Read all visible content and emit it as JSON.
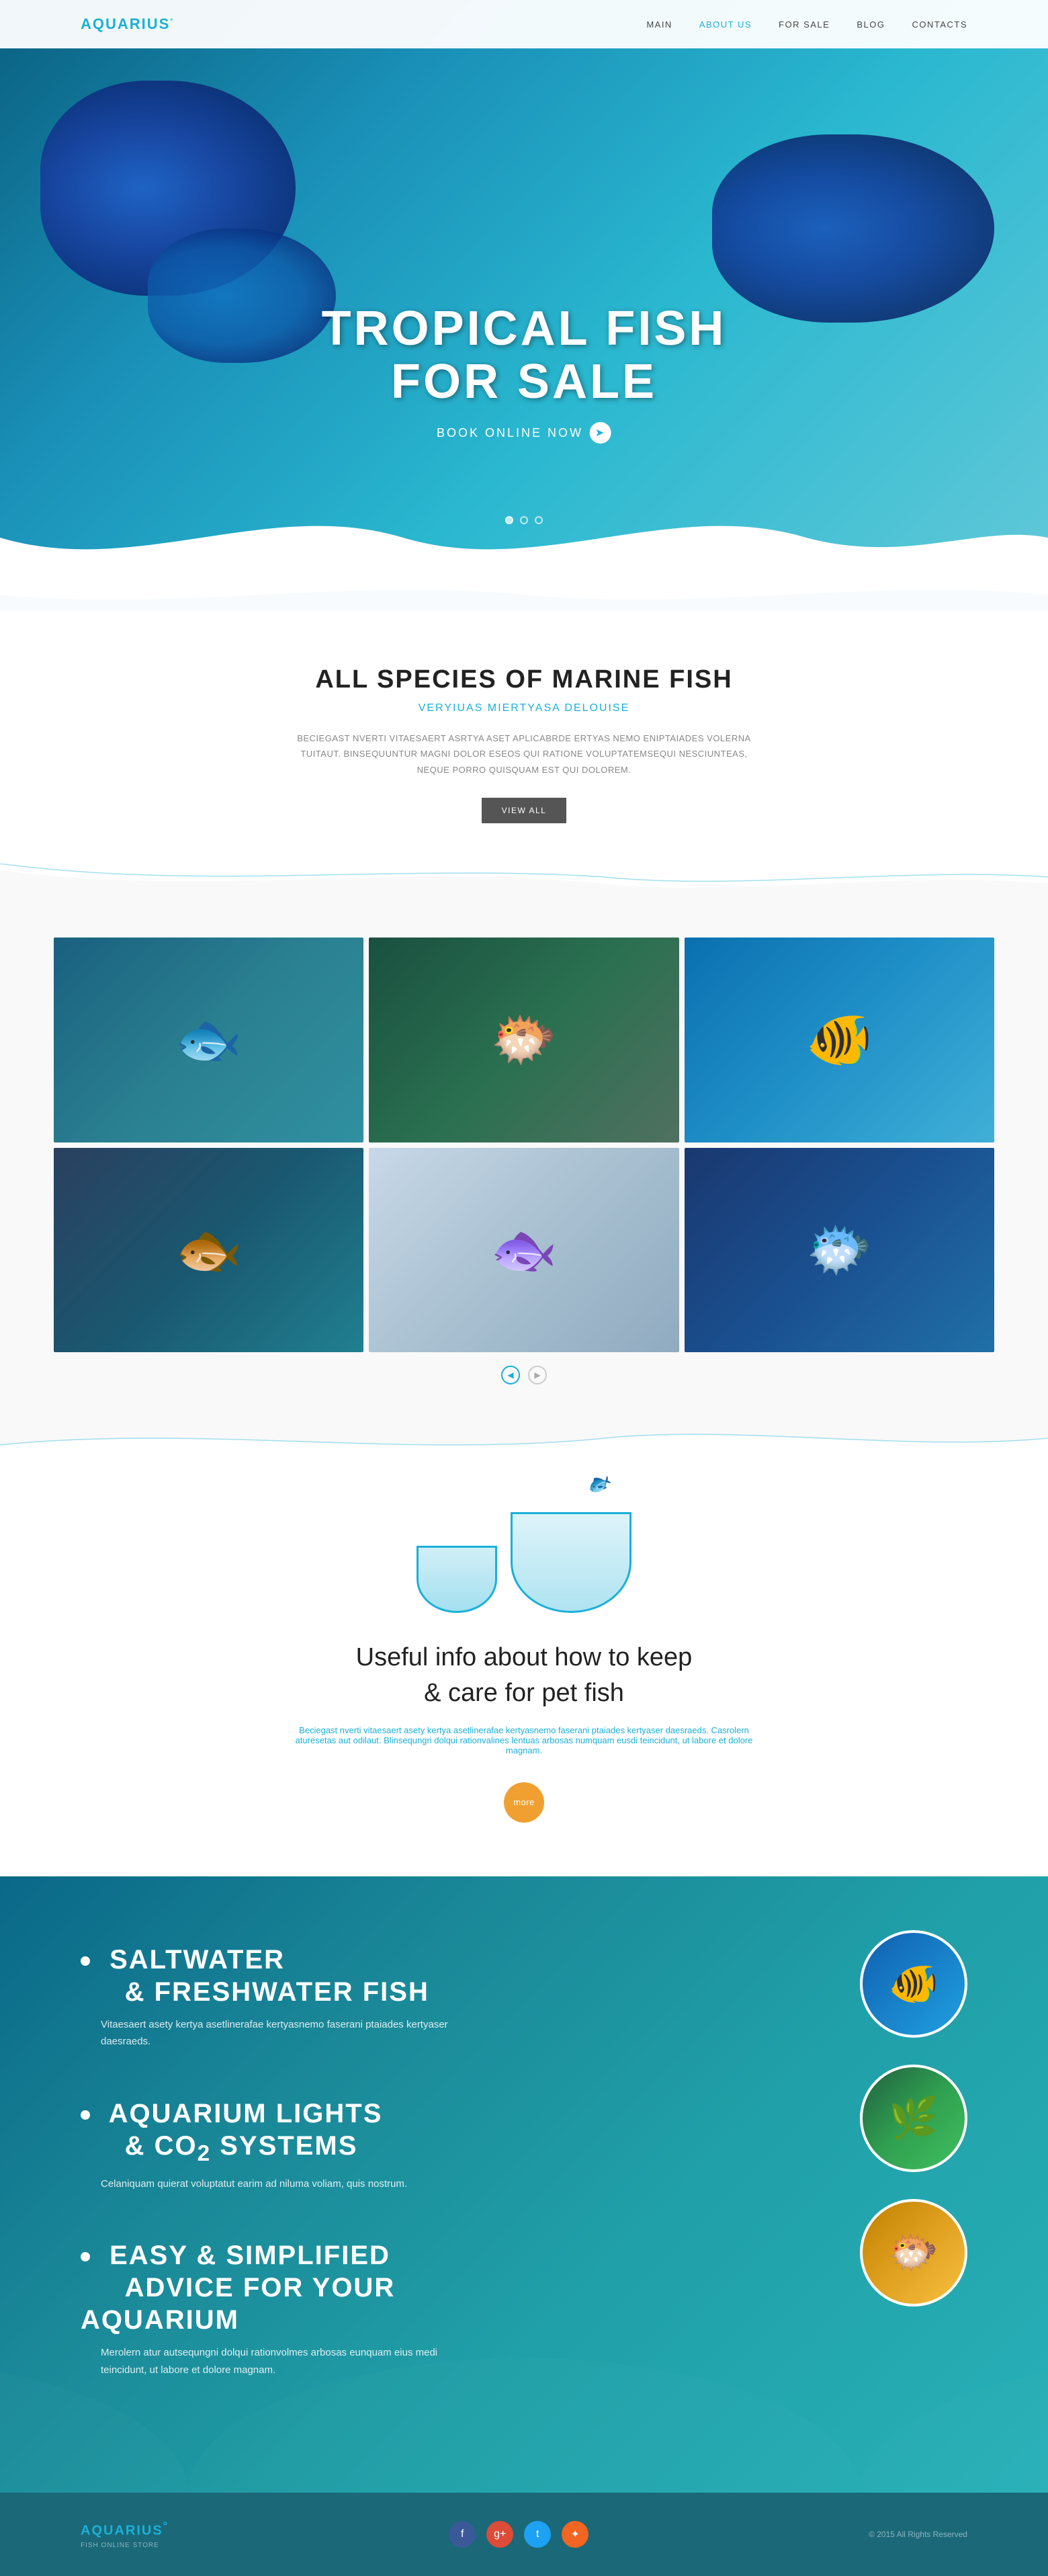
{
  "nav": {
    "logo": "AQUARIUS",
    "logo_sup": "°",
    "links": [
      {
        "label": "MAIN",
        "href": "#",
        "active": false
      },
      {
        "label": "ABOUT US",
        "href": "#",
        "active": true
      },
      {
        "label": "FOR SALE",
        "href": "#",
        "active": false
      },
      {
        "label": "BLOG",
        "href": "#",
        "active": false
      },
      {
        "label": "CONTACTS",
        "href": "#",
        "active": false
      }
    ]
  },
  "hero": {
    "title_line1": "TROPICAL FISH",
    "title_line2": "FOR SALE",
    "cta": "BOOK ONLINE NOW",
    "dots": [
      true,
      false,
      false
    ]
  },
  "species_section": {
    "heading": "ALL SPECIES OF MARINE FISH",
    "subtitle": "VERYIUAS MIERTYASA DELOUISE",
    "description": "BECIEGAST NVERTI VITAESAERT ASRTYA ASET APLICABRDE ERTYAS NEMO ENIPTAIADES VOLERNA TUITAUT. BINSEQUUNTUR MAGNI DOLOR ESEOS QUI RATIONE VOLUPTATEMSEQUI NESCIUNTEAS, NEQUE PORRO QUISQUAM EST QUI DOLOREM.",
    "view_all_label": "VIEW ALL"
  },
  "fish_gallery": {
    "fish": [
      {
        "id": 1,
        "alt": "Silver fish"
      },
      {
        "id": 2,
        "alt": "Puffer fish"
      },
      {
        "id": 3,
        "alt": "Tropical orange fish"
      },
      {
        "id": 4,
        "alt": "Blue cichlid"
      },
      {
        "id": 5,
        "alt": "Grey fish"
      },
      {
        "id": 6,
        "alt": "Blue spotted fish"
      }
    ]
  },
  "info_section": {
    "heading_line1": "Useful info about how to keep",
    "heading_line2": "& care for pet fish",
    "link_text": "Beciegast nverti vitaesaert asety kertya asetlinerafae kertyasnemo faserani ptaiades kertyaser daesraeds. Casrolern aturesetas aut odilaut. Blinsequngri dolqui rationvalines lentuas arbosas numquam eusdi teincidunt, ut labore et dolore magnam.",
    "more_label": "more"
  },
  "features_section": {
    "features": [
      {
        "title": "SALTWATER\n& FRESHWATER FISH",
        "description": "Vitaesaert asety kertya asetlinerafae kertyasnemo faserani ptaiades kertyaser daesraeds.",
        "emoji": "🐠"
      },
      {
        "title": "AQUARIUM LIGHTS\n& CO2 SYSTEMS",
        "description": "Celaniquam quierat voluptatut earim ad niluma voliam, quis nostrum.",
        "emoji": "🌿"
      },
      {
        "title": "EASY & SIMPLIFIED\nADVICE FOR YOUR AQUARIUM",
        "description": "Merolern atur autsequngni dolqui rationvolmes arbosas eunquam eius medi teincidunt, ut labore et dolore magnam.",
        "emoji": "🐡"
      }
    ]
  },
  "footer": {
    "logo": "AQUARIUS",
    "logo_sup": "°",
    "tagline": "FISH ONLINE STORE",
    "copyright": "© 2015 All Rights Reserved",
    "socials": [
      {
        "name": "facebook",
        "icon": "f",
        "class": "social-fb"
      },
      {
        "name": "google-plus",
        "icon": "g+",
        "class": "social-gp"
      },
      {
        "name": "twitter",
        "icon": "t",
        "class": "social-tw"
      },
      {
        "name": "rss",
        "icon": "✦",
        "class": "social-rss"
      }
    ]
  }
}
